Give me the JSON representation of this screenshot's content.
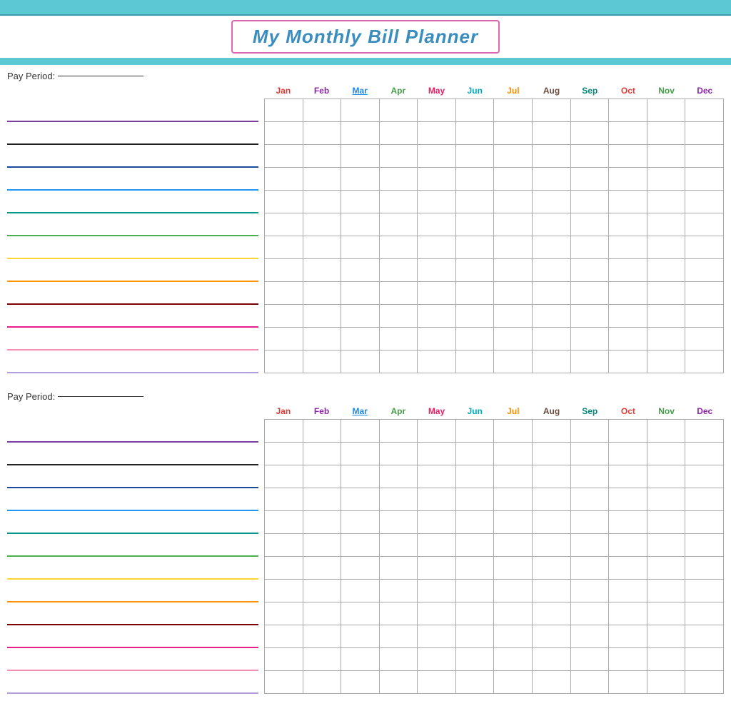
{
  "header": {
    "title": "My Monthly Bill Planner",
    "banner_color": "#5bc8d4"
  },
  "months": [
    {
      "label": "Jan",
      "class": "jan"
    },
    {
      "label": "Feb",
      "class": "feb"
    },
    {
      "label": "Mar",
      "class": "mar"
    },
    {
      "label": "Apr",
      "class": "apr"
    },
    {
      "label": "May",
      "class": "may"
    },
    {
      "label": "Jun",
      "class": "jun"
    },
    {
      "label": "Jul",
      "class": "jul"
    },
    {
      "label": "Aug",
      "class": "aug"
    },
    {
      "label": "Sep",
      "class": "sep"
    },
    {
      "label": "Oct",
      "class": "oct"
    },
    {
      "label": "Nov",
      "class": "nov"
    },
    {
      "label": "Dec",
      "class": "dec"
    }
  ],
  "section1": {
    "pay_period_label": "Pay Period:",
    "rows": 12
  },
  "section2": {
    "pay_period_label": "Pay Period:",
    "rows": 12
  },
  "line_colors": [
    "purple",
    "black",
    "navy",
    "blue",
    "teal",
    "green",
    "yellow",
    "orange",
    "darkred",
    "magenta",
    "pink",
    "lavender"
  ]
}
